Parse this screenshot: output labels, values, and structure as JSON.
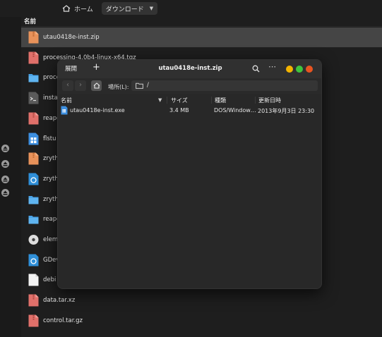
{
  "background": {
    "breadcrumb": {
      "home_label": "ホーム",
      "folder_label": "ダウンロード"
    },
    "column_header": "名前",
    "files": [
      {
        "name": "utau0418e-inst.zip",
        "icon": "archive-orange-icon",
        "selected": true
      },
      {
        "name": "processing-4.0b4-linux-x64.tgz",
        "icon": "archive-red-icon"
      },
      {
        "name": "proce",
        "icon": "folder-icon"
      },
      {
        "name": "insta",
        "icon": "script-icon"
      },
      {
        "name": "reape",
        "icon": "archive-red-icon"
      },
      {
        "name": "flstu",
        "icon": "windows-exe-icon"
      },
      {
        "name": "zryth",
        "icon": "archive-orange-icon"
      },
      {
        "name": "zryth",
        "icon": "package-icon"
      },
      {
        "name": "zryth",
        "icon": "folder-icon"
      },
      {
        "name": "reape",
        "icon": "folder-icon"
      },
      {
        "name": "eleme",
        "icon": "disc-icon"
      },
      {
        "name": "GDev",
        "icon": "package-icon"
      },
      {
        "name": "debi",
        "icon": "document-icon"
      },
      {
        "name": "data.tar.xz",
        "icon": "archive-red-icon"
      },
      {
        "name": "control.tar.gz",
        "icon": "archive-red-icon"
      }
    ]
  },
  "archive_window": {
    "open_button": "展開",
    "add_button": "+",
    "title": "utau0418e-inst.zip",
    "menu_button": "⋯",
    "location_label": "場所(L):",
    "path": "/",
    "columns": {
      "name": "名前",
      "size": "サイズ",
      "type": "種類",
      "modified": "更新日時"
    },
    "rows": [
      {
        "name": "utau0418e-inst.exe",
        "size": "3.4 MB",
        "type": "DOS/Window…",
        "modified": "2013年9月3日 23:30"
      }
    ]
  },
  "colors": {
    "close": "#e95420",
    "minimize": "#f4b400",
    "maximize": "#3ec43e",
    "selected_row": "#454545"
  }
}
